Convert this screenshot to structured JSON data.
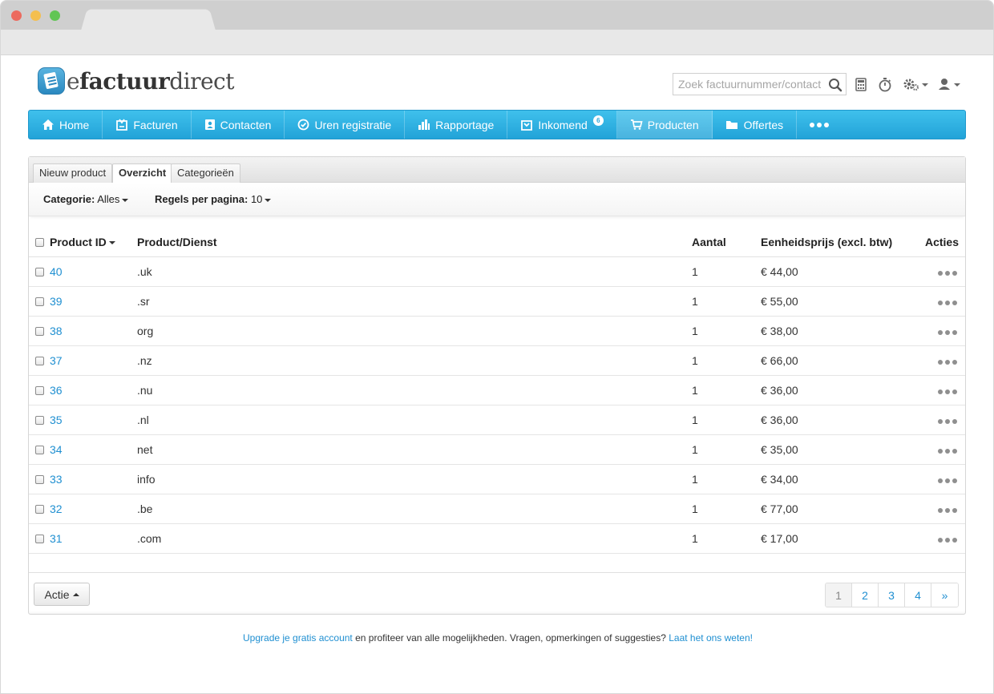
{
  "app": {
    "logo_prefix": "e",
    "logo_strong": "factuur",
    "logo_suffix": "direct"
  },
  "search": {
    "placeholder": "Zoek factuurnummer/contact"
  },
  "nav": {
    "items": [
      {
        "label": "Home",
        "icon": "home-icon"
      },
      {
        "label": "Facturen",
        "icon": "invoice-icon"
      },
      {
        "label": "Contacten",
        "icon": "contacts-icon"
      },
      {
        "label": "Uren registratie",
        "icon": "clock-icon"
      },
      {
        "label": "Rapportage",
        "icon": "bar-chart-icon"
      },
      {
        "label": "Inkomend",
        "icon": "inbox-icon",
        "badge": "6"
      },
      {
        "label": "Producten",
        "icon": "cart-icon",
        "active": true
      },
      {
        "label": "Offertes",
        "icon": "folder-icon"
      }
    ]
  },
  "tabs": {
    "new_product": "Nieuw product",
    "overview": "Overzicht",
    "categories": "Categorieën"
  },
  "filters": {
    "category_label": "Categorie:",
    "category_value": "Alles",
    "rows_label": "Regels per pagina:",
    "rows_value": "10"
  },
  "table": {
    "headers": {
      "product_id": "Product ID",
      "product": "Product/Dienst",
      "quantity": "Aantal",
      "unit_price": "Eenheidsprijs (excl. btw)",
      "actions": "Acties"
    },
    "rows": [
      {
        "id": "40",
        "product": ".uk",
        "qty": "1",
        "price": "€ 44,00"
      },
      {
        "id": "39",
        "product": ".sr",
        "qty": "1",
        "price": "€ 55,00"
      },
      {
        "id": "38",
        "product": "org",
        "qty": "1",
        "price": "€ 38,00"
      },
      {
        "id": "37",
        "product": ".nz",
        "qty": "1",
        "price": "€ 66,00"
      },
      {
        "id": "36",
        "product": ".nu",
        "qty": "1",
        "price": "€ 36,00"
      },
      {
        "id": "35",
        "product": ".nl",
        "qty": "1",
        "price": "€ 36,00"
      },
      {
        "id": "34",
        "product": "net",
        "qty": "1",
        "price": "€ 35,00"
      },
      {
        "id": "33",
        "product": "info",
        "qty": "1",
        "price": "€ 34,00"
      },
      {
        "id": "32",
        "product": ".be",
        "qty": "1",
        "price": "€ 77,00"
      },
      {
        "id": "31",
        "product": ".com",
        "qty": "1",
        "price": "€ 17,00"
      }
    ]
  },
  "bottom": {
    "action_button": "Actie",
    "pages": [
      "1",
      "2",
      "3",
      "4",
      "»"
    ],
    "current_page": "1"
  },
  "footer": {
    "upgrade_link": "Upgrade je gratis account",
    "middle_text": " en profiteer van alle mogelijkheden. Vragen, opmerkingen of suggesties? ",
    "feedback_link": "Laat het ons weten!"
  },
  "colors": {
    "nav_blue": "#2aaee0",
    "link_blue": "#1f8fd1"
  }
}
